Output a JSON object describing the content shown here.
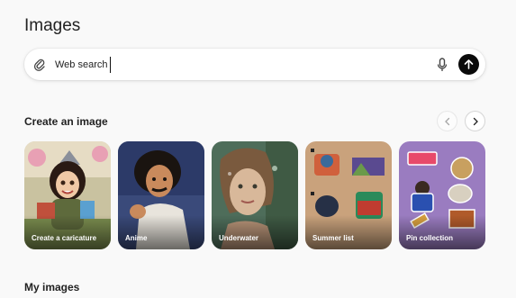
{
  "page": {
    "title": "Images"
  },
  "search": {
    "value": "Web search"
  },
  "create_section": {
    "title": "Create an image",
    "cards": [
      {
        "label": "Create a caricature",
        "bg": "#c9c2a0"
      },
      {
        "label": "Anime",
        "bg": "#3a4a7a"
      },
      {
        "label": "Underwater",
        "bg": "#4e6d5a"
      },
      {
        "label": "Summer list",
        "bg": "#c9a27c"
      },
      {
        "label": "Pin collection",
        "bg": "#9a7cc0"
      }
    ]
  },
  "my_images": {
    "title": "My images"
  }
}
